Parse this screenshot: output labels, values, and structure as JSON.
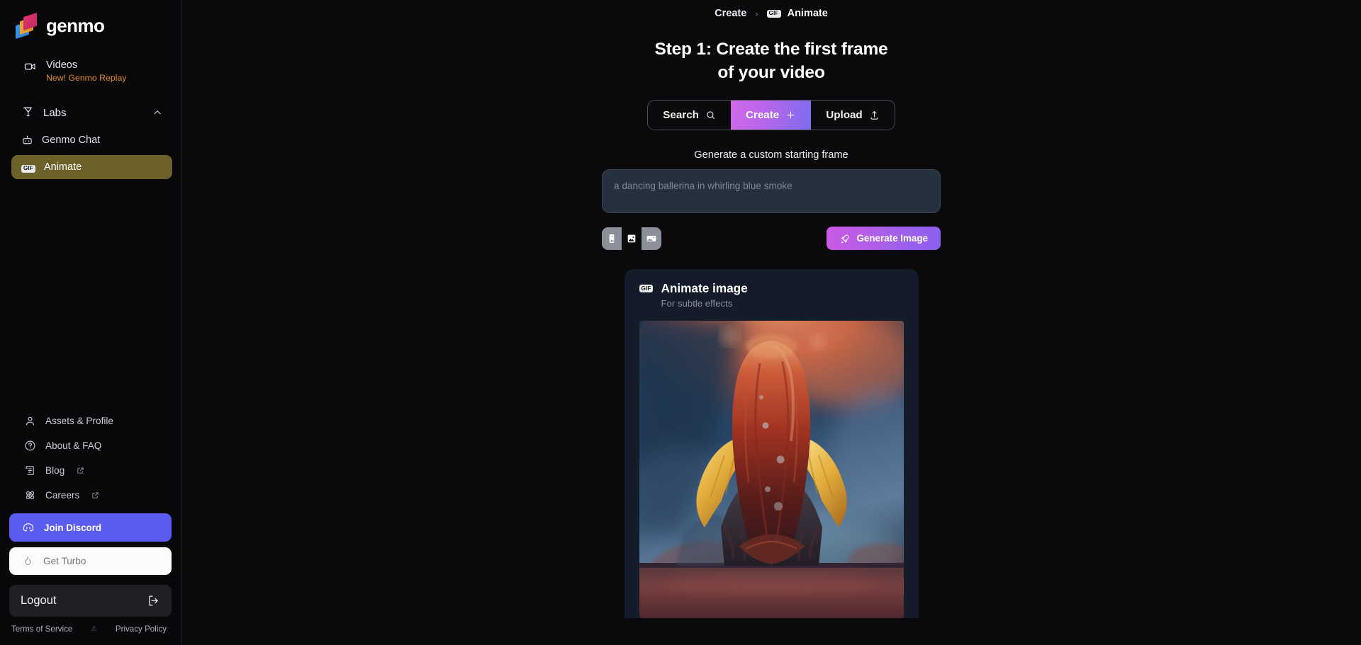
{
  "app": {
    "brand": "genmo"
  },
  "sidebar": {
    "videos": {
      "label": "Videos",
      "sublabel": "New! Genmo Replay",
      "icon": "video-camera-icon"
    },
    "labs": {
      "label": "Labs",
      "icon": "flask-icon",
      "chevron": "chevron-up-icon",
      "expanded": true
    },
    "lab_items": [
      {
        "label": "Genmo Chat",
        "icon": "robot-icon",
        "active": false
      },
      {
        "label": "Animate",
        "icon": "gif-badge-icon",
        "active": true,
        "badge": "GIF"
      }
    ],
    "links": [
      {
        "label": "Assets & Profile",
        "icon": "user-icon",
        "external": false
      },
      {
        "label": "About & FAQ",
        "icon": "question-circle-icon",
        "external": false
      },
      {
        "label": "Blog",
        "icon": "scroll-icon",
        "external": true
      },
      {
        "label": "Careers",
        "icon": "atom-icon",
        "external": true
      }
    ],
    "discord": {
      "label": "Join Discord",
      "icon": "discord-icon",
      "color": "#5b5bef"
    },
    "turbo": {
      "label": "Get Turbo",
      "icon": "flame-icon",
      "color": "#fbfbfc"
    },
    "logout": {
      "label": "Logout",
      "icon": "logout-icon"
    },
    "legal": {
      "terms": "Terms of Service",
      "separator": "⚠",
      "privacy": "Privacy Policy"
    }
  },
  "header": {
    "breadcrumb_root": "Create",
    "breadcrumb_separator": "›",
    "breadcrumb_current": "Animate",
    "breadcrumb_badge": "GIF"
  },
  "main": {
    "heading_line1": "Step 1: Create the first frame",
    "heading_line2": "of your video",
    "tabs": [
      {
        "label": "Search",
        "icon": "search-icon",
        "active": false
      },
      {
        "label": "Create",
        "icon": "plus-icon",
        "active": true
      },
      {
        "label": "Upload",
        "icon": "upload-icon",
        "active": false
      }
    ],
    "prompt_section_label": "Generate a custom starting frame",
    "prompt_value": "",
    "prompt_placeholder": "a dancing ballerina in whirling blue smoke",
    "ratios": [
      {
        "name": "portrait",
        "icon": "image-portrait-icon",
        "selected": false
      },
      {
        "name": "square",
        "icon": "image-square-icon",
        "selected": true
      },
      {
        "name": "landscape",
        "icon": "image-landscape-icon",
        "selected": false
      }
    ],
    "generate_button": {
      "label": "Generate Image",
      "icon": "rocket-icon"
    },
    "card": {
      "badge": "GIF",
      "title": "Animate image",
      "subtitle": "For subtle effects",
      "preview_alt": "figure with flowing red hair and golden feathered shoulders under an orange and blue sky"
    }
  },
  "colors": {
    "accent_purple": "#a95fe9",
    "accent_pink": "#cc5ae6",
    "discord_blue": "#5b5bef",
    "active_olive": "#6c6128",
    "orange_new": "#e08b2a",
    "bg": "#0a0a0c",
    "card_bg": "#141c2a",
    "input_bg": "#26313f"
  }
}
